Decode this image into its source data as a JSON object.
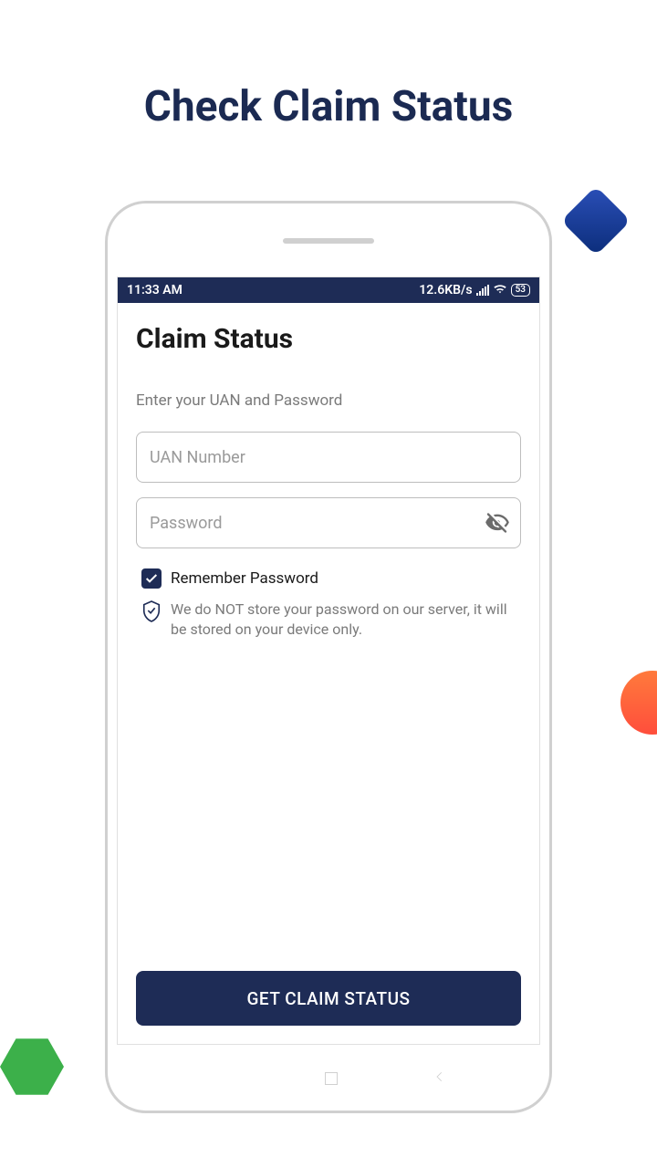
{
  "page": {
    "title": "Check Claim Status"
  },
  "status_bar": {
    "time": "11:33 AM",
    "data_rate": "12.6KB/s",
    "battery": "53"
  },
  "app": {
    "title": "Claim Status",
    "prompt": "Enter your UAN and Password",
    "uan_placeholder": "UAN Number",
    "password_placeholder": "Password",
    "remember_label": "Remember Password",
    "remember_checked": true,
    "info_text": "We do NOT store your password on our server, it will be stored on your device only.",
    "submit_label": "GET CLAIM STATUS"
  }
}
